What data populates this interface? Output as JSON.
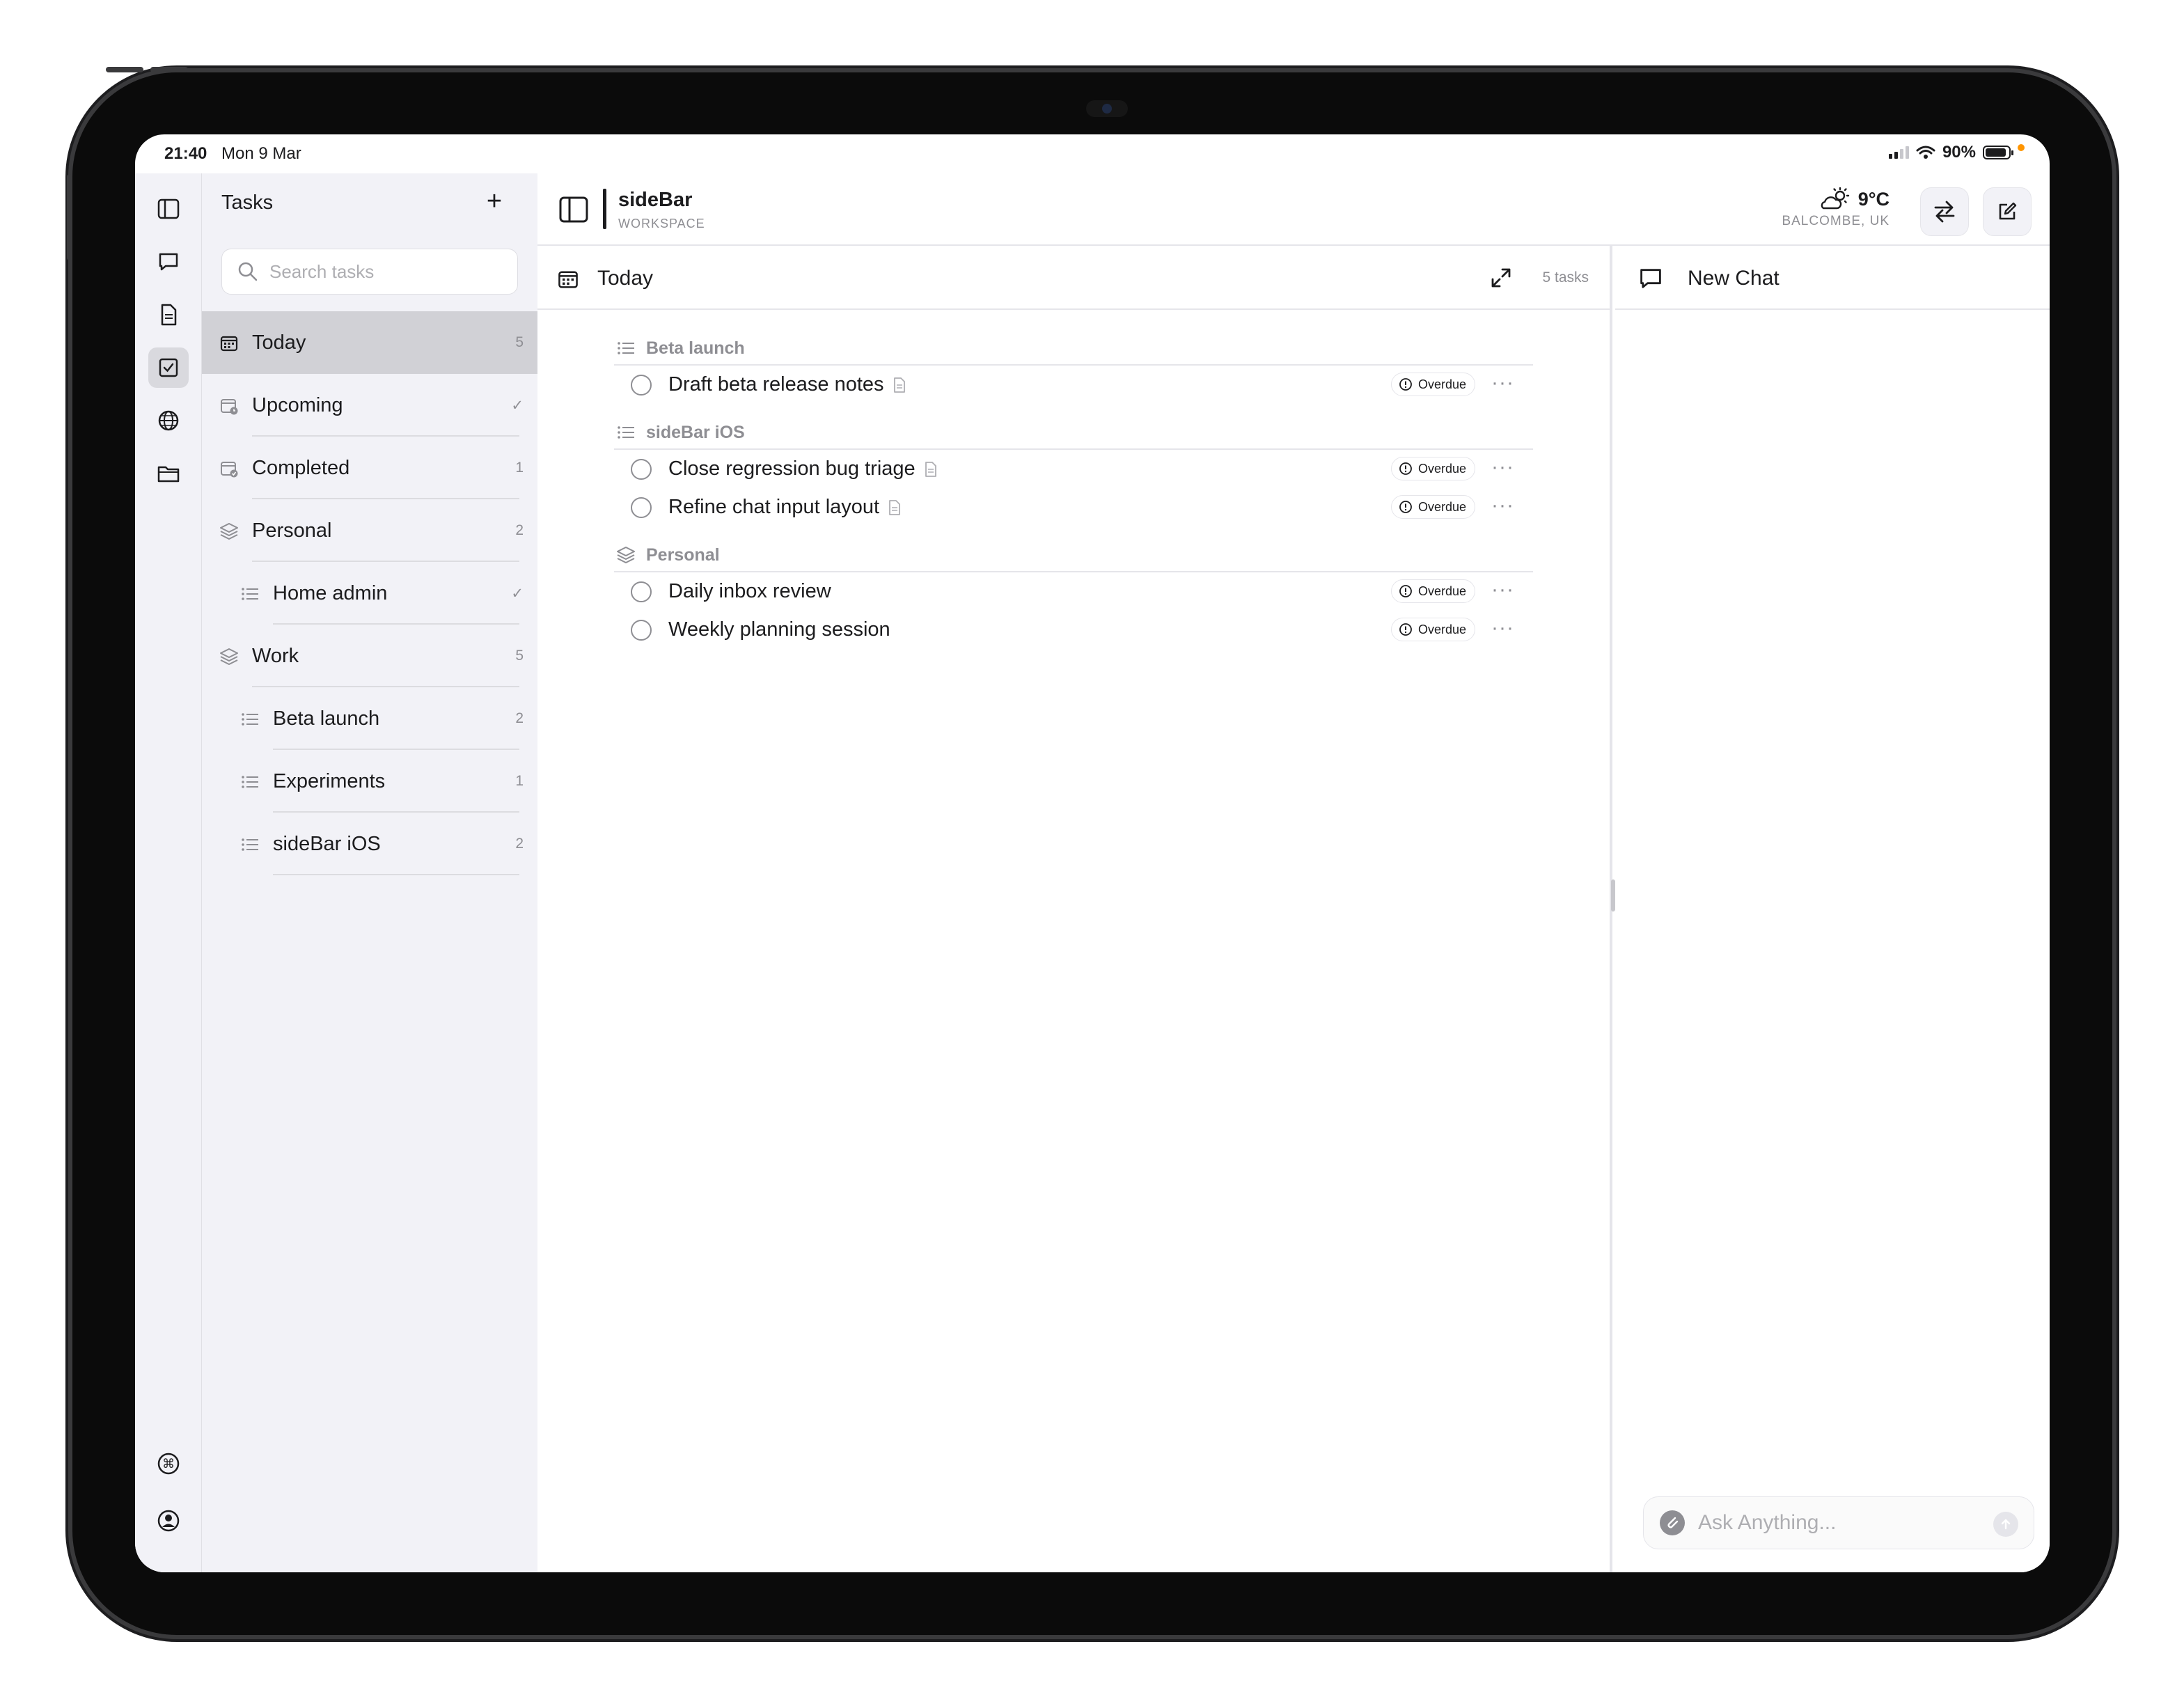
{
  "status_bar": {
    "time": "21:40",
    "date": "Mon 9 Mar",
    "battery": "90%",
    "battery_level": 0.9
  },
  "rail": {
    "items": [
      {
        "icon": "sidebar-toggle-icon"
      },
      {
        "icon": "chat-bubble-icon"
      },
      {
        "icon": "document-icon"
      },
      {
        "icon": "checkbox-icon",
        "active": true
      },
      {
        "icon": "globe-icon"
      },
      {
        "icon": "folder-icon"
      }
    ],
    "bottom": [
      {
        "icon": "command-icon"
      },
      {
        "icon": "account-icon"
      }
    ]
  },
  "tasks_sidebar": {
    "title": "Tasks",
    "add_label": "+",
    "search_placeholder": "Search tasks",
    "items": [
      {
        "label": "Today",
        "count": "5",
        "icon": "calendar-icon",
        "active": true
      },
      {
        "label": "Upcoming",
        "count": "✓",
        "icon": "calendar-clock-icon"
      },
      {
        "label": "Completed",
        "count": "1",
        "icon": "calendar-check-icon"
      },
      {
        "label": "Personal",
        "count": "2",
        "icon": "stack-icon"
      },
      {
        "label": "Home admin",
        "count": "✓",
        "icon": "list-icon",
        "sub": true
      },
      {
        "label": "Work",
        "count": "5",
        "icon": "stack-icon"
      },
      {
        "label": "Beta launch",
        "count": "2",
        "icon": "list-icon",
        "sub": true
      },
      {
        "label": "Experiments",
        "count": "1",
        "icon": "list-icon",
        "sub": true
      },
      {
        "label": "sideBar iOS",
        "count": "2",
        "icon": "list-icon",
        "sub": true
      }
    ]
  },
  "header": {
    "title": "sideBar",
    "subtitle": "WORKSPACE",
    "weather": {
      "temp": "9°C",
      "location": "BALCOMBE, UK",
      "icon": "partly-cloudy-icon"
    }
  },
  "today_pane": {
    "title": "Today",
    "count": "5 tasks",
    "groups": [
      {
        "name": "Beta launch",
        "icon": "list-icon",
        "tasks": [
          {
            "label": "Draft beta release notes",
            "badge": "Overdue",
            "has_note": true
          }
        ]
      },
      {
        "name": "sideBar iOS",
        "icon": "list-icon",
        "tasks": [
          {
            "label": "Close regression bug triage",
            "badge": "Overdue",
            "has_note": true
          },
          {
            "label": "Refine chat input layout",
            "badge": "Overdue",
            "has_note": true
          }
        ]
      },
      {
        "name": "Personal",
        "icon": "stack-icon",
        "tasks": [
          {
            "label": "Daily inbox review",
            "badge": "Overdue",
            "has_note": false
          },
          {
            "label": "Weekly planning session",
            "badge": "Overdue",
            "has_note": false
          }
        ]
      }
    ]
  },
  "chat": {
    "title": "New Chat",
    "input_placeholder": "Ask Anything..."
  },
  "colors": {
    "sidebar_bg": "#f2f2f7",
    "active_bg": "#d1d1d6",
    "muted_text": "#8e8e93",
    "status_dot": "#ff9500"
  }
}
